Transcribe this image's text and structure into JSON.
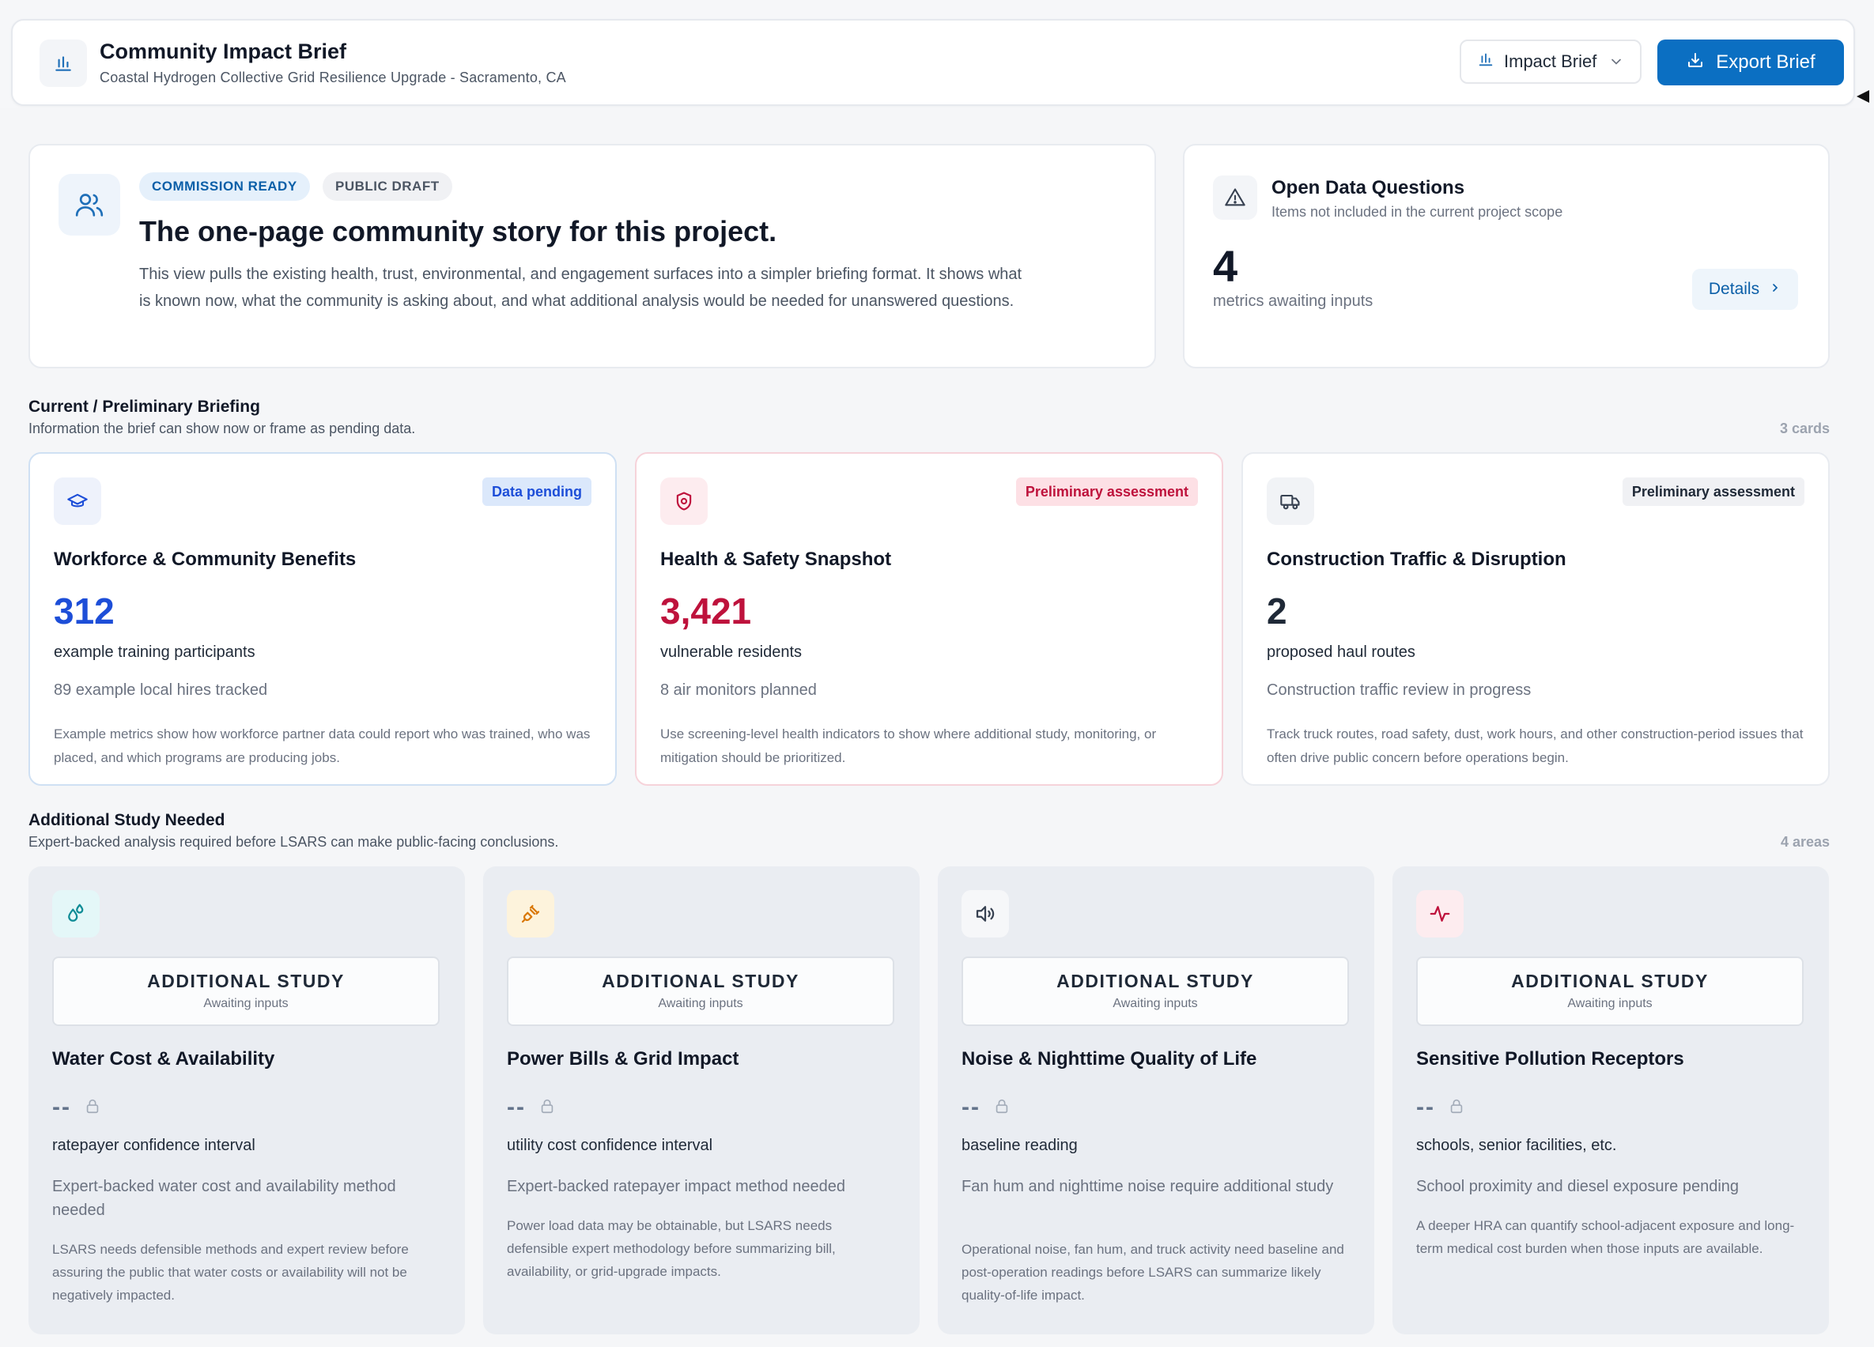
{
  "header": {
    "title": "Community Impact Brief",
    "subtitle": "Coastal Hydrogen Collective Grid Resilience Upgrade - Sacramento, CA",
    "view_select": "Impact Brief",
    "export_label": "Export Brief"
  },
  "hero": {
    "badge_ready": "COMMISSION READY",
    "badge_draft": "PUBLIC DRAFT",
    "title": "The one-page community story for this project.",
    "text": "This view pulls the existing health, trust, environmental, and engagement surfaces into a simpler briefing format. It shows what is known now, what the community is asking about, and what additional analysis would be needed for unanswered questions."
  },
  "open_questions": {
    "title": "Open Data Questions",
    "subtitle": "Items not included in the current project scope",
    "count": "4",
    "label": "metrics awaiting inputs",
    "details_label": "Details"
  },
  "prelim": {
    "title": "Current / Preliminary Briefing",
    "subtitle": "Information the brief can show now or frame as pending data.",
    "count": "3 cards",
    "cards": [
      {
        "badge": "Data pending",
        "title": "Workforce & Community Benefits",
        "value": "312",
        "label": "example training participants",
        "secondary": "89 example local hires tracked",
        "description": "Example metrics show how workforce partner data could report who was trained, who was placed, and which programs are producing jobs.",
        "accent": "#1d4ed8"
      },
      {
        "badge": "Preliminary assessment",
        "title": "Health & Safety Snapshot",
        "value": "3,421",
        "label": "vulnerable residents",
        "secondary": "8 air monitors planned",
        "description": "Use screening-level health indicators to show where additional study, monitoring, or mitigation should be prioritized.",
        "accent": "#be123c"
      },
      {
        "badge": "Preliminary assessment",
        "title": "Construction Traffic & Disruption",
        "value": "2",
        "label": "proposed haul routes",
        "secondary": "Construction traffic review in progress",
        "description": "Track truck routes, road safety, dust, work hours, and other construction-period issues that often drive public concern before operations begin.",
        "accent": "#1f2937"
      }
    ]
  },
  "study": {
    "title": "Additional Study Needed",
    "subtitle": "Expert-backed analysis required before LSARS can make public-facing conclusions.",
    "count": "4 areas",
    "cards": [
      {
        "box_title": "ADDITIONAL STUDY",
        "box_sub": "Awaiting inputs",
        "title": "Water Cost & Availability",
        "value": "--",
        "label": "ratepayer confidence interval",
        "secondary": "Expert-backed water cost and availability method needed",
        "description": "LSARS needs defensible methods and expert review before assuring the public that water costs or availability will not be negatively impacted."
      },
      {
        "box_title": "ADDITIONAL STUDY",
        "box_sub": "Awaiting inputs",
        "title": "Power Bills & Grid Impact",
        "value": "--",
        "label": "utility cost confidence interval",
        "secondary": "Expert-backed ratepayer impact method needed",
        "description": "Power load data may be obtainable, but LSARS needs defensible expert methodology before summarizing bill, availability, or grid-upgrade impacts."
      },
      {
        "box_title": "ADDITIONAL STUDY",
        "box_sub": "Awaiting inputs",
        "title": "Noise & Nighttime Quality of Life",
        "value": "--",
        "label": "baseline reading",
        "secondary": "Fan hum and nighttime noise require additional study",
        "description": "Operational noise, fan hum, and truck activity need baseline and post-operation readings before LSARS can summarize likely quality-of-life impact."
      },
      {
        "box_title": "ADDITIONAL STUDY",
        "box_sub": "Awaiting inputs",
        "title": "Sensitive Pollution Receptors",
        "value": "--",
        "label": "schools, senior facilities, etc.",
        "secondary": "School proximity and diesel exposure pending",
        "description": "A deeper HRA can quantify school-adjacent exposure and long-term medical cost burden when those inputs are available."
      }
    ]
  }
}
